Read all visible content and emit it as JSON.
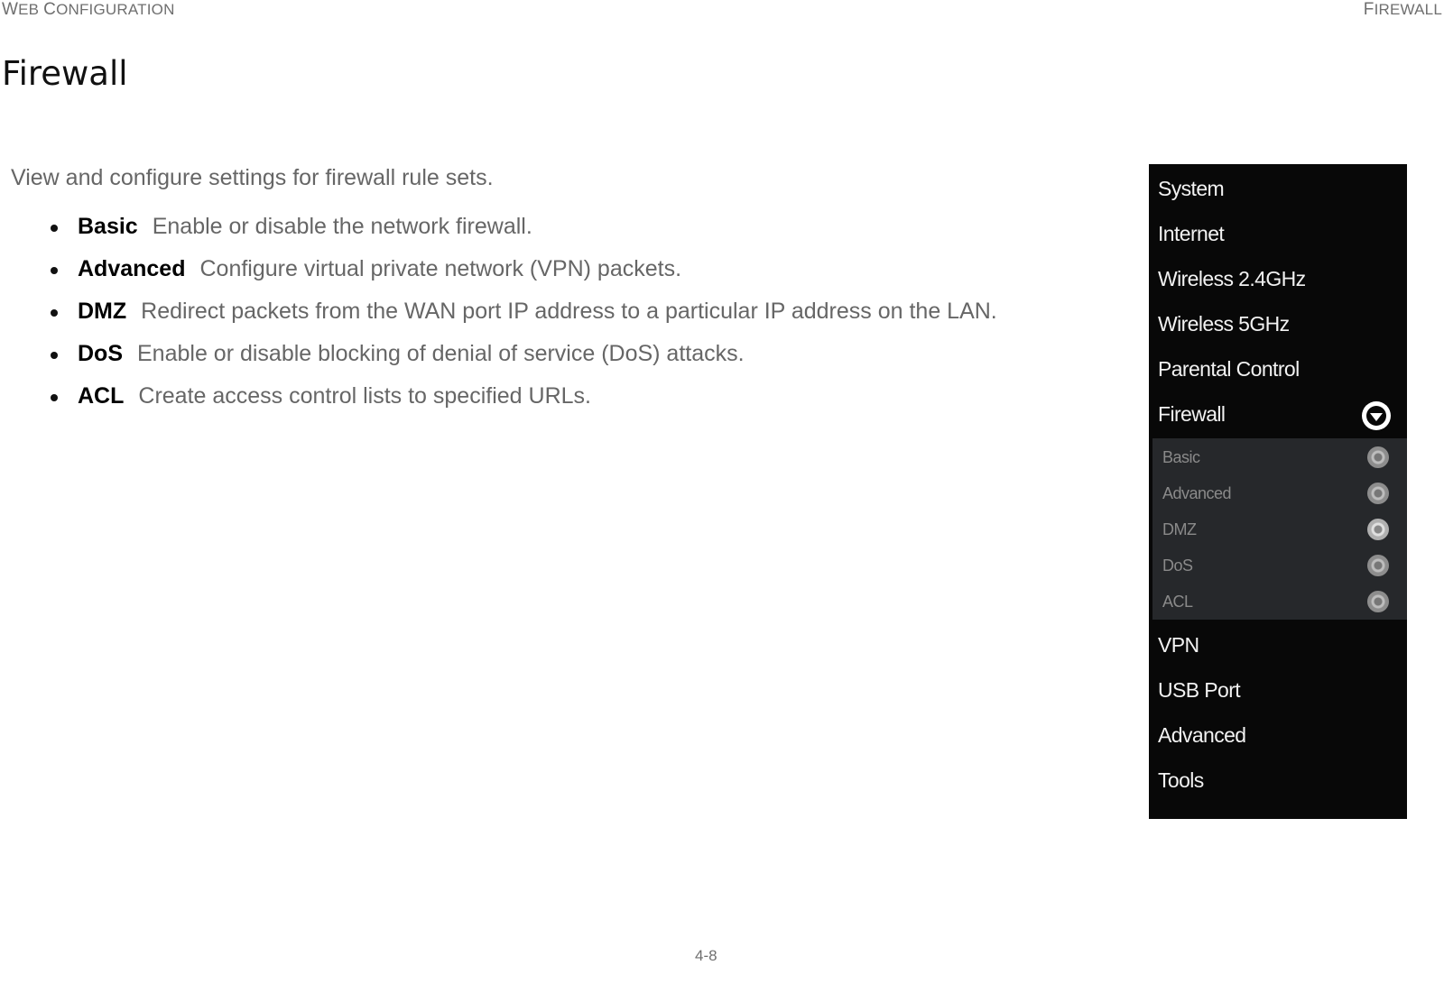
{
  "header": {
    "left": {
      "first": "W",
      "rest": "EB ",
      "first2": "C",
      "rest2": "ONFIGURATION"
    },
    "right": {
      "first": "F",
      "rest": "IREWALL"
    }
  },
  "page_title": "Firewall",
  "intro": "View and configure settings for firewall rule sets.",
  "bullets": [
    {
      "term": "Basic",
      "desc": "Enable or disable the network firewall."
    },
    {
      "term": "Advanced",
      "desc": "Configure virtual private network (VPN) packets."
    },
    {
      "term": "DMZ",
      "desc": "Redirect packets from the WAN port IP address to a particular IP address on the LAN."
    },
    {
      "term": "DoS",
      "desc": "Enable or disable blocking of denial of service (DoS) attacks."
    },
    {
      "term": "ACL",
      "desc": "Create access control lists to specified URLs."
    }
  ],
  "menu": {
    "items": [
      "System",
      "Internet",
      "Wireless 2.4GHz",
      "Wireless 5GHz",
      "Parental Control",
      "Firewall"
    ],
    "expanded_item": "Firewall",
    "sub_items": [
      "Basic",
      "Advanced",
      "DMZ",
      "DoS",
      "ACL"
    ],
    "selected_sub_item": "DMZ",
    "items_after": [
      "VPN",
      "USB Port",
      "Advanced",
      "Tools"
    ]
  },
  "page_number": "4-8"
}
